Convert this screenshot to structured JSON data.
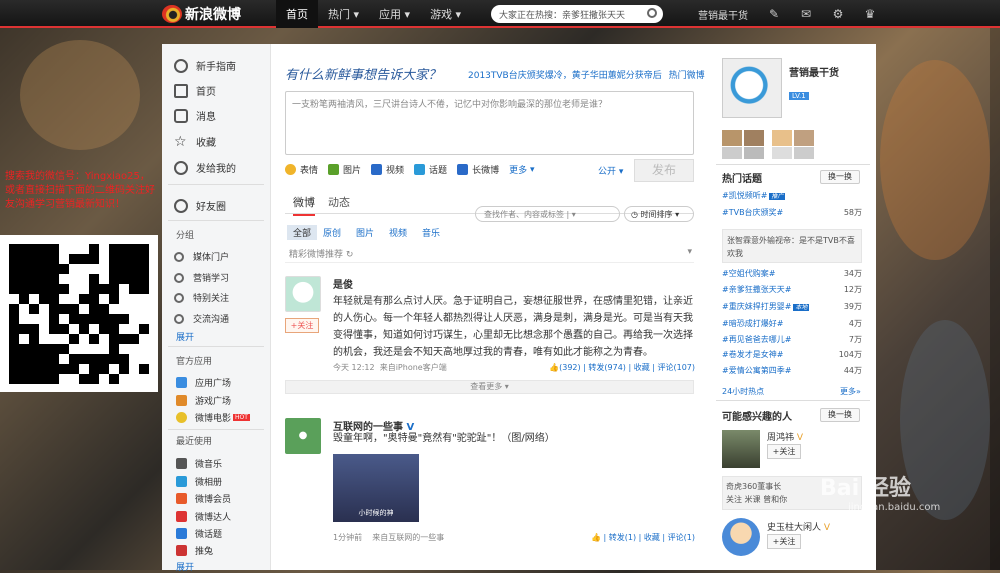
{
  "header": {
    "logo_text": "新浪微博",
    "nav": [
      "首页",
      "热门",
      "应用",
      "游戏"
    ],
    "search_placeholder": "大家正在热搜：亲爹狂撒张天天",
    "user_name": "营销最干货"
  },
  "promo": {
    "text": "搜索我的微信号：Yingxiao25，或者直接扫描下面的二维码关注好友沟通学习营销最新知识！"
  },
  "sidebar": {
    "main": [
      "新手指南",
      "首页",
      "消息",
      "收藏",
      "发给我的"
    ],
    "friends": "好友圈",
    "groups_title": "分组",
    "groups": [
      "媒体门户",
      "营销学习",
      "特别关注",
      "交流沟通"
    ],
    "groups_more": "展开",
    "apps_title": "官方应用",
    "apps": [
      "应用广场",
      "游戏广场",
      "微博电影"
    ],
    "hot_badge": "HOT",
    "recent_title": "最近使用",
    "recent": [
      "微音乐",
      "微相册",
      "微博会员",
      "微博达人",
      "微话题",
      "推兔"
    ],
    "recent_more": "展开"
  },
  "composer": {
    "title": "有什么新鲜事想告诉大家？",
    "links": [
      "2013TVB台庆颁奖爆冷，黄子华田蕙妮分获帝后",
      "热门微博"
    ],
    "placeholder": "一支粉笔两袖清风，三尺讲台诗人不倦，记忆中对你影响最深的那位老师是谁？",
    "tools": [
      "表情",
      "图片",
      "视频",
      "话题",
      "长微博",
      "更多"
    ],
    "visibility": "公开",
    "post_label": "发布"
  },
  "feed": {
    "tabs": [
      "微博",
      "动态"
    ],
    "search_placeholder": "查找作者、内容或标签",
    "sort_label": "时间排序",
    "filters": [
      "全部",
      "原创",
      "图片",
      "视频",
      "音乐"
    ],
    "recommend_label": "精彩微博推荐",
    "posts": [
      {
        "name": "是俊",
        "follow": "+关注",
        "text": "年轻就是有那么点讨人厌。急于证明自己，妄想征服世界，在感情里犯错，让亲近的人伤心。每一个年轻人都热烈得让人厌恶，满身是刺，满身是光。可是当有天我变得懂事，知道如何讨巧谋生，心里却无比想念那个愚蠢的自己。再给我一次选择的机会，我还是会不知天高地厚过我的青春，唯有如此才能称之为青春。",
        "time": "今天 12:12",
        "source": "来自iPhone客户端",
        "likes": "(392)",
        "repost": "转发(974)",
        "fav": "收藏",
        "comment": "评论(107)",
        "more": "查看更多"
      },
      {
        "name": "互联网的一些事",
        "text": "毁童年啊，\"奥特曼\"竟然有\"驼驼趾\"！（图/网络）",
        "image_caption": "小时候的神",
        "time": "1分钟前",
        "source": "来自互联网的一些事",
        "repost": "转发(1)",
        "fav": "收藏",
        "comment": "评论(1)"
      }
    ]
  },
  "right": {
    "user_name": "营销最干货",
    "level": "LV.1",
    "hot_title": "热门话题",
    "swap_label": "换一换",
    "topics": [
      {
        "name": "#凯悦频听#",
        "tag": "推广",
        "count": ""
      },
      {
        "name": "#TVB台庆颁奖#",
        "count": "58万"
      },
      {
        "name": "#空姐代购案#",
        "count": "34万"
      },
      {
        "name": "#亲爹狂撒张天天#",
        "count": "12万"
      },
      {
        "name": "#重庆妹捍打男婴#",
        "tag": "本地",
        "count": "39万"
      },
      {
        "name": "#暗恐成打爆好#",
        "count": "4万"
      },
      {
        "name": "#再见爸爸去哪儿#",
        "count": "7万"
      },
      {
        "name": "#卷发才是女神#",
        "count": "104万"
      },
      {
        "name": "#爱情公寓第四季#",
        "count": "44万"
      }
    ],
    "news_box": "张智霖意外输视帝：是不是TVB不喜欢我",
    "hot_footer": "24小时热点",
    "hot_more": "更多»",
    "interest_title": "可能感兴趣的人",
    "people": [
      {
        "name": "周鸿祎",
        "follow": "+关注"
      },
      {
        "name": "史玉柱大闲人",
        "follow": "+关注"
      }
    ],
    "interest_note": "奇虎360董事长",
    "interest_note2": "关注 米课 曾和你"
  },
  "watermark": {
    "text": "Bai 经验",
    "sub": "jingyan.baidu.com"
  }
}
